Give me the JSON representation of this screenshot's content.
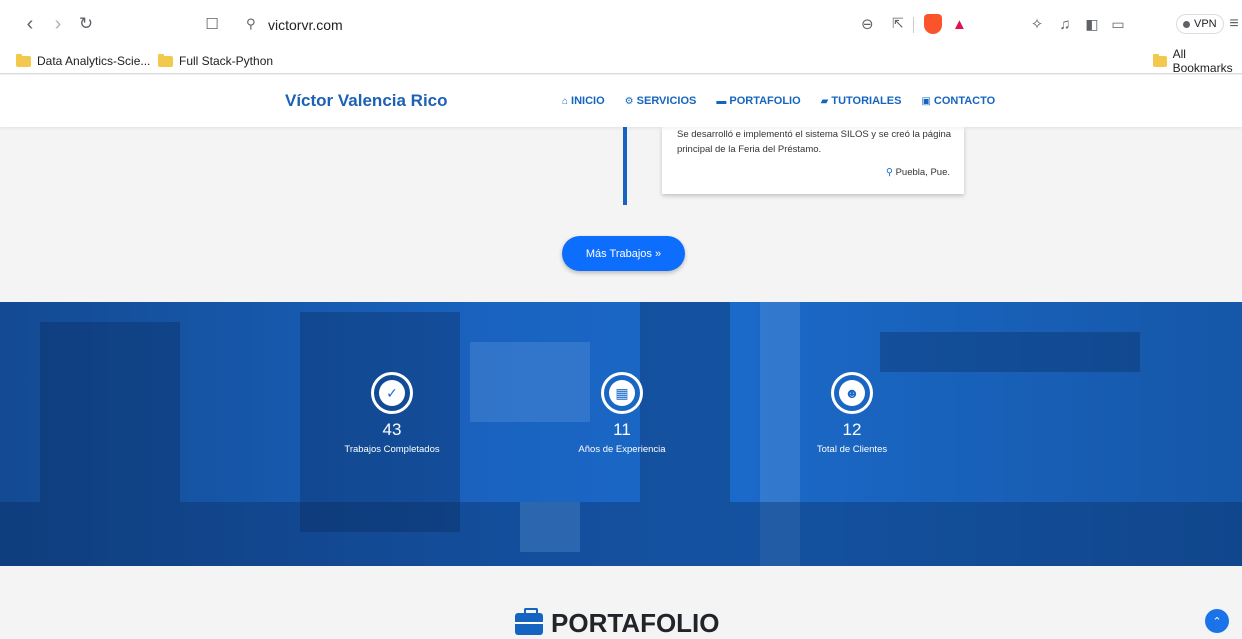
{
  "browser": {
    "url": "victorvr.com",
    "vpn_label": "VPN",
    "bookmarks": [
      "Data Analytics-Scie...",
      "Full Stack-Python"
    ],
    "all_bookmarks": "All Bookmarks"
  },
  "nav": {
    "brand": "Víctor Valencia Rico",
    "items": [
      {
        "icon": "home-icon",
        "label": "INICIO"
      },
      {
        "icon": "cogs-icon",
        "label": "SERVICIOS"
      },
      {
        "icon": "briefcase-icon",
        "label": "PORTAFOLIO"
      },
      {
        "icon": "book-icon",
        "label": "TUTORIALES"
      },
      {
        "icon": "contact-card-icon",
        "label": "CONTACTO"
      }
    ]
  },
  "timeline": {
    "card_text": "Se desarrolló e implementó el sistema SILOS y se creó la página principal de la Feria del Préstamo.",
    "location": "Puebla, Pue.",
    "more_button": "Más Trabajos »"
  },
  "stats": [
    {
      "icon": "check-circle-icon",
      "value": "43",
      "label": "Trabajos Completados"
    },
    {
      "icon": "calendar-icon",
      "value": "11",
      "label": "Años de Experiencia"
    },
    {
      "icon": "users-icon",
      "value": "12",
      "label": "Total de Clientes"
    }
  ],
  "portfolio": {
    "title": "PORTAFOLIO"
  },
  "colors": {
    "accent": "#1565c0",
    "button": "#0d6efd",
    "banner": "#1b69c8"
  }
}
